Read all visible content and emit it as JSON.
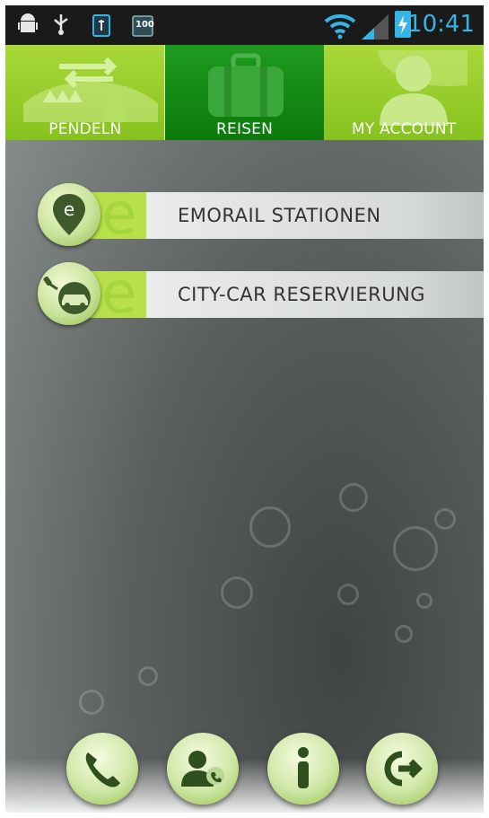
{
  "status_bar": {
    "time": "10:41",
    "battery_label": "100",
    "icons": [
      "android-debug-icon",
      "usb-icon",
      "battery-app-icon",
      "battery-100-icon",
      "wifi-icon",
      "signal-icon",
      "charging-battery-icon"
    ]
  },
  "tabs": [
    {
      "label": "PENDELN",
      "icon": "commute-icon",
      "active": false
    },
    {
      "label": "REISEN",
      "icon": "suitcase-icon",
      "active": true
    },
    {
      "label": "MY ACCOUNT",
      "icon": "user-icon",
      "active": false
    }
  ],
  "menu": [
    {
      "label": "EMORAIL STATIONEN",
      "icon": "location-pin-e-icon"
    },
    {
      "label": "CITY-CAR RESERVIERUNG",
      "icon": "car-key-icon"
    }
  ],
  "bottom_buttons": [
    {
      "icon": "phone-icon"
    },
    {
      "icon": "contact-call-icon"
    },
    {
      "icon": "info-icon"
    },
    {
      "icon": "logout-icon"
    }
  ],
  "colors": {
    "tab_green": "#a9d83a",
    "tab_active": "#0b7a0b",
    "accent_blue": "#35b5e5"
  }
}
